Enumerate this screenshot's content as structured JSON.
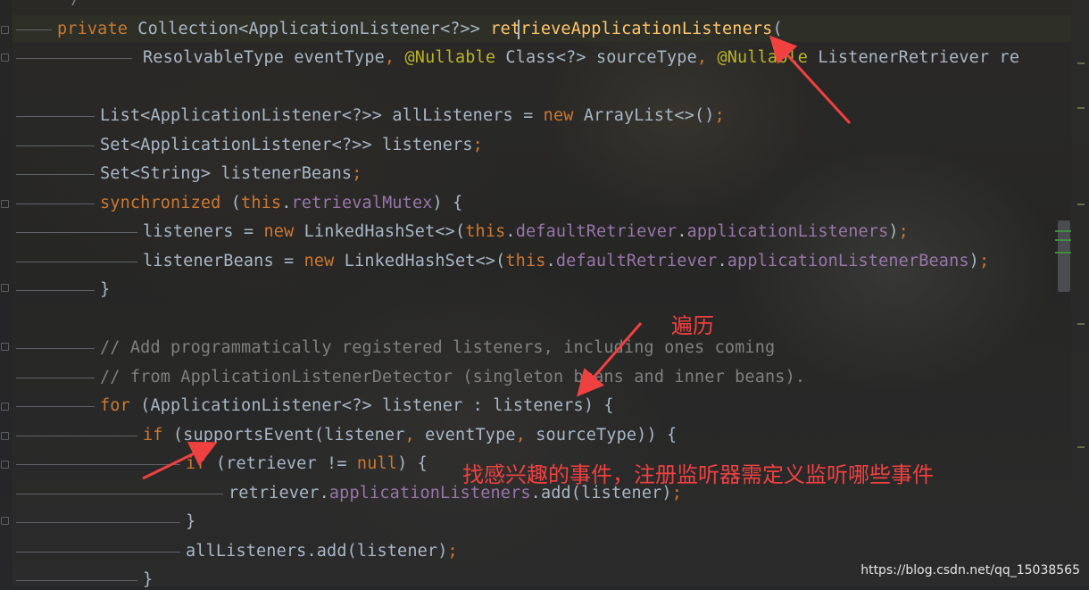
{
  "editor": {
    "comment_end": "*/",
    "lines": [
      "private Collection<ApplicationListener<?>> retrieveApplicationListeners(",
      "ResolvableType eventType, @Nullable Class<?> sourceType, @Nullable ListenerRetriever re",
      "List<ApplicationListener<?>> allListeners = new ArrayList<>();",
      "Set<ApplicationListener<?>> listeners;",
      "Set<String> listenerBeans;",
      "synchronized (this.retrievalMutex) {",
      "listeners = new LinkedHashSet<>(this.defaultRetriever.applicationListeners);",
      "listenerBeans = new LinkedHashSet<>(this.defaultRetriever.applicationListenerBeans);",
      "}",
      "// Add programmatically registered listeners, including ones coming",
      "// from ApplicationListenerDetector (singleton beans and inner beans).",
      "for (ApplicationListener<?> listener : listeners) {",
      "if (supportsEvent(listener, eventType, sourceType)) {",
      "if (retriever != null) {",
      "retriever.applicationListeners.add(listener);",
      "}",
      "allListeners.add(listener);",
      "}"
    ]
  },
  "annotations": {
    "traverse": "遍历",
    "find_interested": "找感兴趣的事件，注册监听器需定义监听哪些事件"
  },
  "watermark": "https://blog.csdn.net/qq_15038565",
  "colors": {
    "keyword": "#cc7832",
    "annotation_color": "#bbb529",
    "method": "#ffc66d",
    "field": "#9876aa",
    "comment": "#808080",
    "text": "#a9b7c6",
    "red_note": "#f04141"
  }
}
